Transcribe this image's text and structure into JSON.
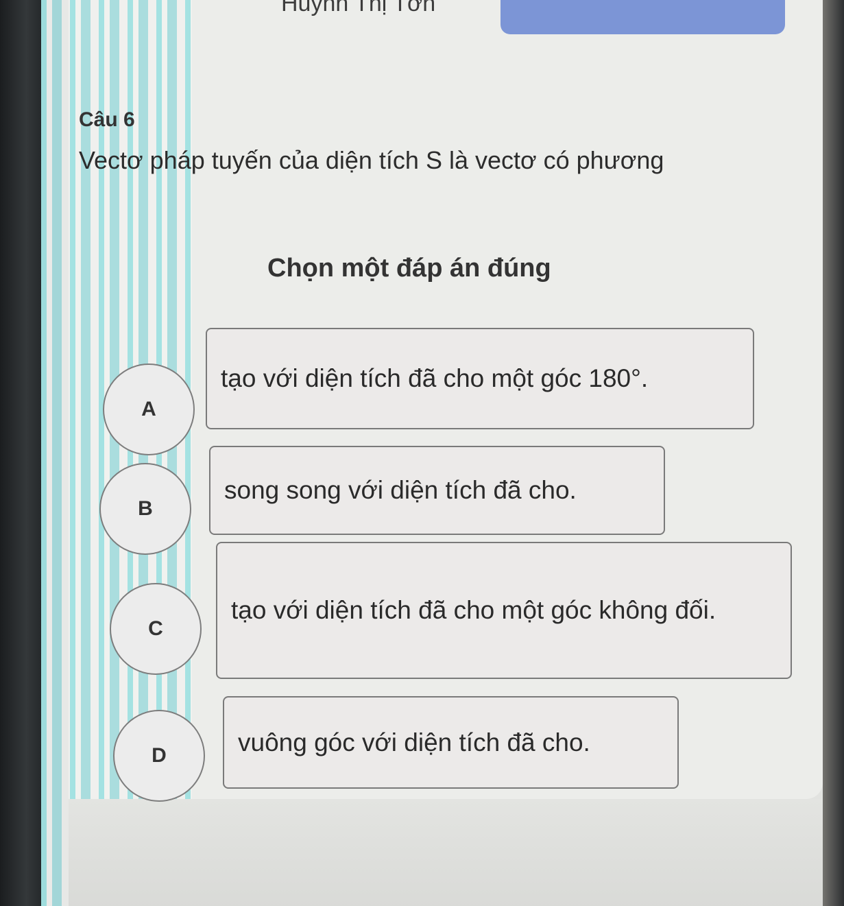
{
  "header": {
    "user_name": "Huỳnh Thị Tơn"
  },
  "question": {
    "number_label": "Câu 6",
    "text": "Vectơ pháp tuyến của diện tích S là vectơ có phương",
    "instruction": "Chọn một đáp án đúng"
  },
  "options": [
    {
      "letter": "A",
      "text": "tạo với diện tích đã cho một góc 180°."
    },
    {
      "letter": "B",
      "text": "song song với diện tích đã cho."
    },
    {
      "letter": "C",
      "text": "tạo với diện tích đã cho một góc không đối."
    },
    {
      "letter": "D",
      "text": "vuông góc với diện tích đã cho."
    }
  ],
  "colors": {
    "header_bar": "#7c95d6",
    "sidebar_accent": "#3cd2d7",
    "card_bg": "#ecedea"
  }
}
